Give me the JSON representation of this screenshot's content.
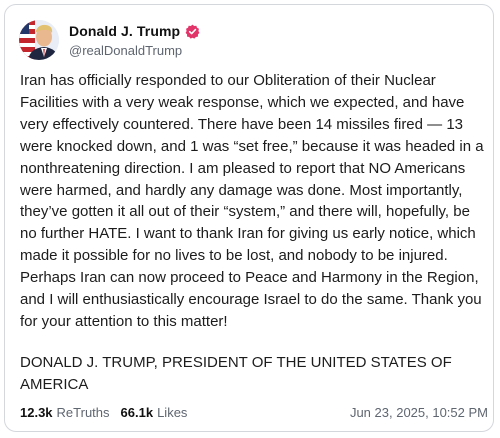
{
  "post": {
    "author": {
      "display_name": "Donald J. Trump",
      "handle": "@realDonaldTrump",
      "verified_icon": "verified-badge-icon",
      "verified_color": "#e2356a",
      "avatar_icon": "avatar-flag-portrait"
    },
    "body": "Iran has officially responded to our Obliteration of their Nuclear Facilities with a very weak response, which we expected, and have very effectively countered. There have been 14 missiles fired — 13 were knocked down, and 1 was “set free,” because it was headed in a nonthreatening direction. I am pleased to report that NO Americans were harmed, and hardly any damage was done. Most importantly, they’ve gotten it all out of their “system,” and there will, hopefully, be no further HATE. I want to thank Iran for giving us early notice, which made it possible for no lives to be lost, and nobody to be injured. Perhaps Iran can now proceed to Peace and Harmony in the Region, and I will enthusiastically encourage Israel to do the same. Thank you for your attention to this matter!",
    "signature": "DONALD J. TRUMP, PRESIDENT OF THE UNITED STATES OF AMERICA",
    "stats": {
      "retruths_count": "12.3k",
      "retruths_label": "ReTruths",
      "likes_count": "66.1k",
      "likes_label": "Likes"
    },
    "timestamp": "Jun 23, 2025, 10:52 PM"
  }
}
